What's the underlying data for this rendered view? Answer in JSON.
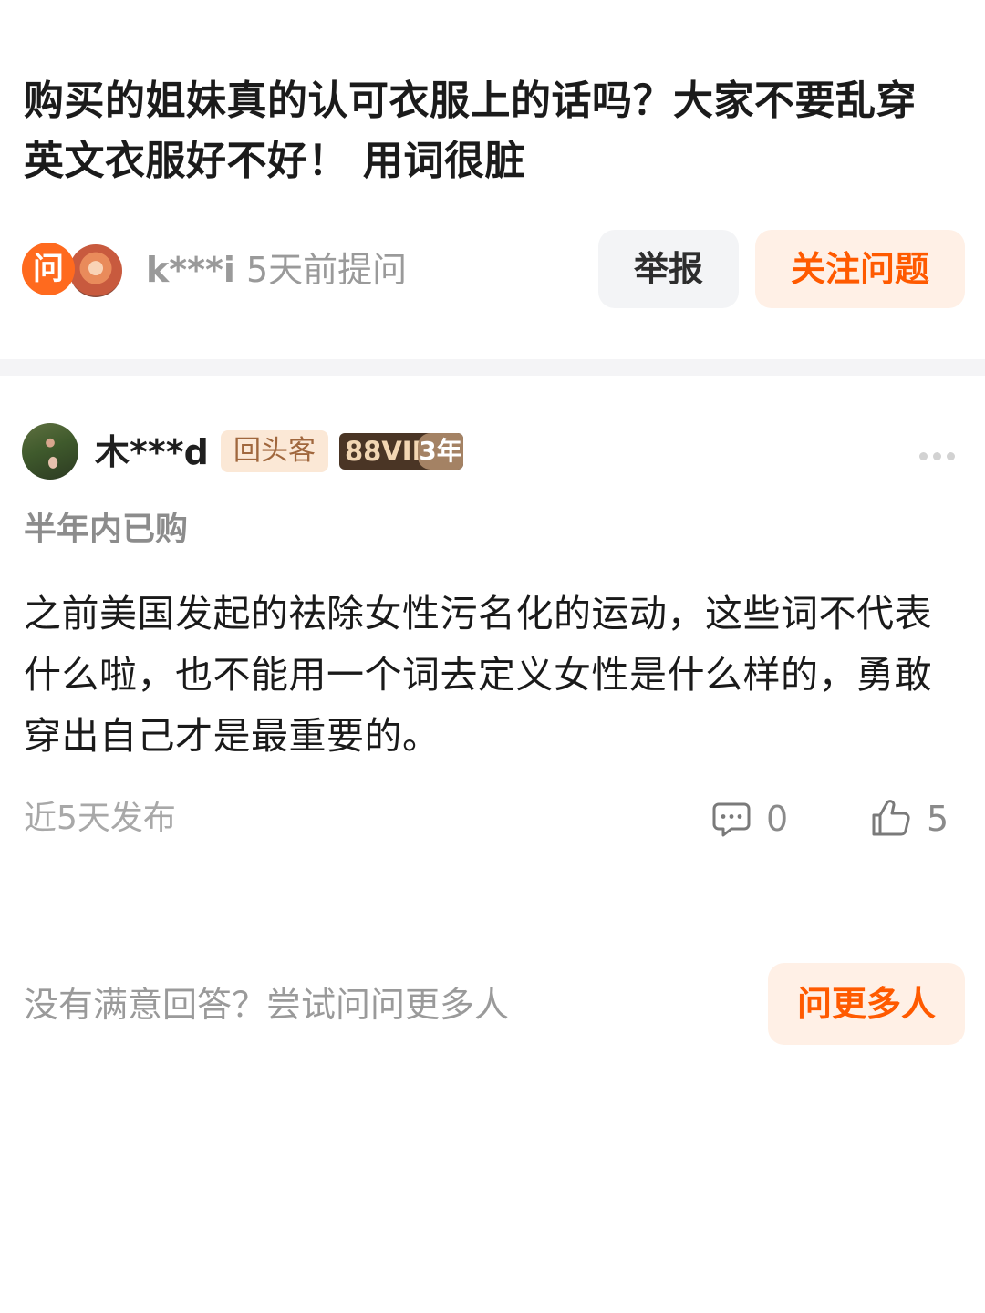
{
  "question": {
    "title": "购买的姐妹真的认可衣服上的话吗？大家不要乱穿英文衣服好不好！ 用词很脏",
    "badge": "问",
    "asker_name": "k***i",
    "asked_time": "5天前提问",
    "report_label": "举报",
    "follow_label": "关注问题"
  },
  "answer": {
    "author_name": "木***d",
    "tag_repeat": "回头客",
    "tag_vip": "88VIP",
    "tag_vip_years": "3年",
    "purchase_note": "半年内已购",
    "content": "之前美国发起的祛除女性污名化的运动，这些词不代表什么啦，也不能用一个词去定义女性是什么样的，勇敢穿出自己才是最重要的。",
    "publish_time": "近5天发布",
    "comment_count": "0",
    "like_count": "5"
  },
  "ask_more": {
    "prompt": "没有满意回答？尝试问问更多人",
    "button_label": "问更多人"
  },
  "colors": {
    "accent": "#ff5a00",
    "accent_bg": "#fff0e6",
    "badge_orange": "#ff6a1e",
    "gray_text": "#9a9a9a"
  },
  "icons": [
    "more-icon",
    "comment-icon",
    "thumbs-up-icon"
  ]
}
